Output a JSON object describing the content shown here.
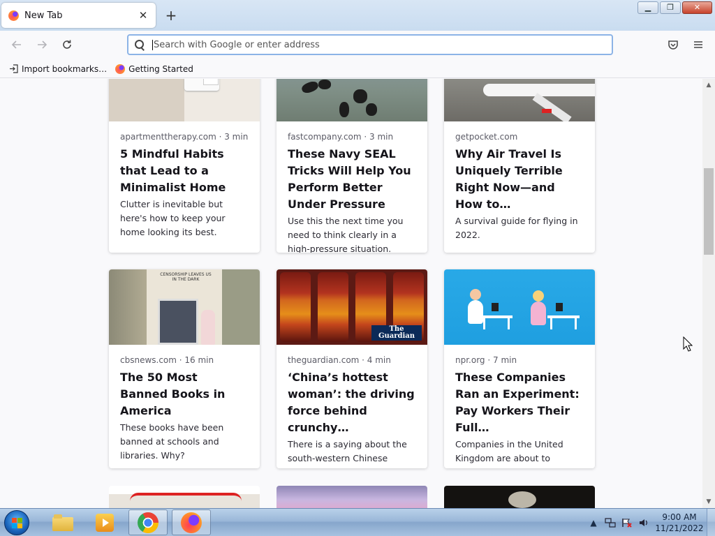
{
  "browser": {
    "tab_title": "New Tab",
    "tab_close_glyph": "✕",
    "new_tab_glyph": "+",
    "window_buttons": {
      "minimize": "▁",
      "maximize": "❐",
      "close": "✕"
    },
    "url_placeholder": "Search with Google or enter address",
    "icons": {
      "back": "back-arrow-icon",
      "forward": "forward-arrow-icon",
      "reload": "reload-icon",
      "pocket": "pocket-icon",
      "menu": "hamburger-menu-icon"
    },
    "bookmarks": [
      {
        "label": "Import bookmarks…",
        "icon": "import-icon"
      },
      {
        "label": "Getting Started",
        "icon": "firefox-icon"
      }
    ]
  },
  "stories": [
    {
      "meta": "apartmenttherapy.com · 3 min",
      "headline": "5 Mindful Habits that Lead to a Minimalist Home",
      "excerpt": "Clutter is inevitable but here's how to keep your home looking its best."
    },
    {
      "meta": "fastcompany.com · 3 min",
      "headline": "These Navy SEAL Tricks Will Help You Perform Better Under Pressure",
      "excerpt": "Use this the next time you need to think clearly in a high-pressure situation."
    },
    {
      "meta": "getpocket.com",
      "headline": "Why Air Travel Is Uniquely Terrible Right Now—and How to…",
      "excerpt": "A survival guide for flying in 2022."
    },
    {
      "meta": "cbsnews.com · 16 min",
      "headline": "The 50 Most Banned Books in America",
      "excerpt": "These books have been banned at schools and libraries. Why?",
      "image_text": "CENSORSHIP LEAVES US IN THE DARK"
    },
    {
      "meta": "theguardian.com · 4 min",
      "headline": "‘China’s hottest woman’: the driving force behind crunchy…",
      "excerpt": "There is a saying about the south-western Chinese province of Guizhou: “Not…",
      "image_text": "The Guardian"
    },
    {
      "meta": "npr.org · 7 min",
      "headline": "These Companies Ran an Experiment: Pay Workers Their Full…",
      "excerpt": "Companies in the United Kingdom are about to complete the biggest trial of…"
    }
  ],
  "taskbar": {
    "items": [
      "start-button",
      "file-explorer",
      "media-player",
      "google-chrome",
      "firefox"
    ],
    "clock_time": "9:00 AM",
    "clock_date": "11/21/2022"
  }
}
